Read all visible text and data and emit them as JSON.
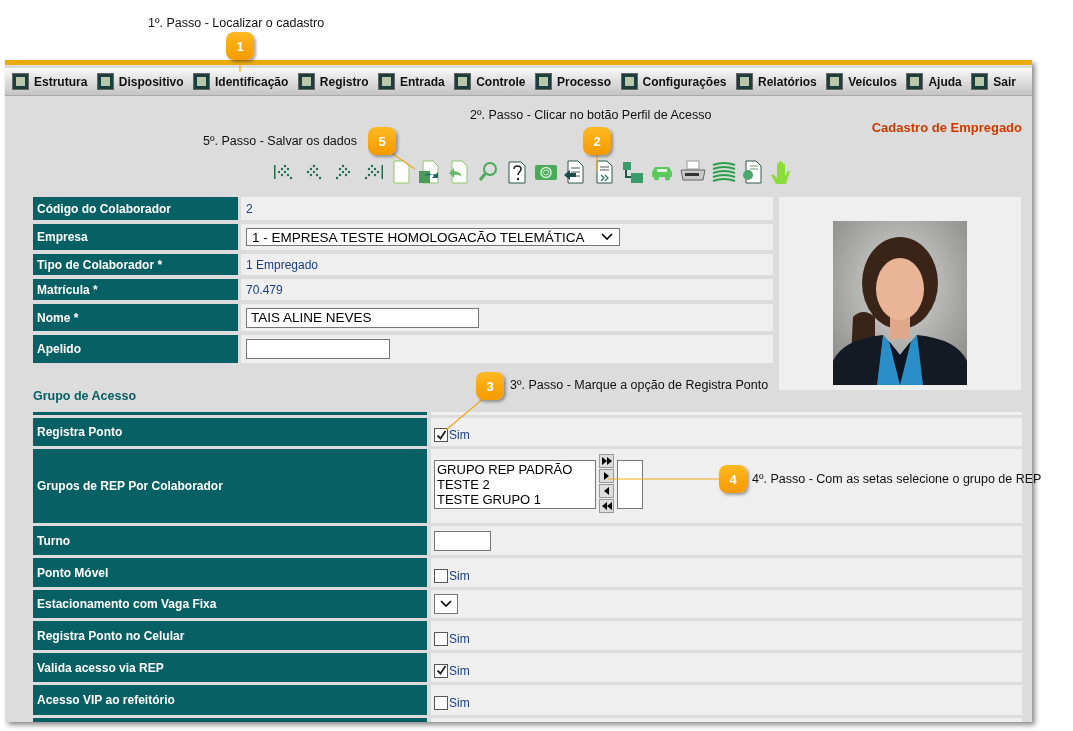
{
  "steps": [
    {
      "number": "1",
      "text": "1º. Passo - Localizar o cadastro"
    },
    {
      "number": "2",
      "text": "2º. Passo - Clicar no botão Perfil de Acesso"
    },
    {
      "number": "3",
      "text": "3º. Passo - Marque a opção de Registra Ponto"
    },
    {
      "number": "4",
      "text": "4º. Passo - Com as setas selecione o grupo de REP"
    },
    {
      "number": "5",
      "text": "5º. Passo - Salvar os dados"
    }
  ],
  "menu": [
    "Estrutura",
    "Dispositivo",
    "Identificação",
    "Registro",
    "Entrada",
    "Controle",
    "Processo",
    "Configurações",
    "Relatórios",
    "Veículos",
    "Ajuda",
    "Sair"
  ],
  "page_title": "Cadastro de Empregado",
  "form": [
    {
      "label": "Código do Colaborador",
      "kind": "text",
      "value": "2"
    },
    {
      "label": "Empresa",
      "kind": "select",
      "value": "1 - EMPRESA TESTE HOMOLOGACÃO TELEMÁTICA"
    },
    {
      "label": "Tipo de Colaborador *",
      "kind": "text",
      "value": "1 Empregado"
    },
    {
      "label": "Matrícula *",
      "kind": "text",
      "value": "70.479"
    },
    {
      "label": "Nome *",
      "kind": "input",
      "value": "TAIS ALINE NEVES"
    },
    {
      "label": "Apelido",
      "kind": "input"
    }
  ],
  "group_title": "Grupo de Acesso",
  "access": [
    {
      "label": "Registra Ponto",
      "kind": "checkbox",
      "checked": true,
      "option": "Sim"
    },
    {
      "label": "Grupos de REP Por Colaborador",
      "kind": "transfer",
      "available": [
        "GRUPO REP PADRÃO",
        "TESTE 2",
        "TESTE GRUPO 1"
      ]
    },
    {
      "label": "Turno",
      "kind": "input"
    },
    {
      "label": "Ponto Móvel",
      "kind": "checkbox",
      "checked": false,
      "option": "Sim"
    },
    {
      "label": "Estacionamento com Vaga Fixa",
      "kind": "select"
    },
    {
      "label": "Registra Ponto no Celular",
      "kind": "checkbox",
      "checked": false,
      "option": "Sim"
    },
    {
      "label": "Valida acesso via REP",
      "kind": "checkbox",
      "checked": true,
      "option": "Sim"
    },
    {
      "label": "Acesso VIP ao refeitório",
      "kind": "checkbox",
      "checked": false,
      "option": "Sim"
    }
  ]
}
